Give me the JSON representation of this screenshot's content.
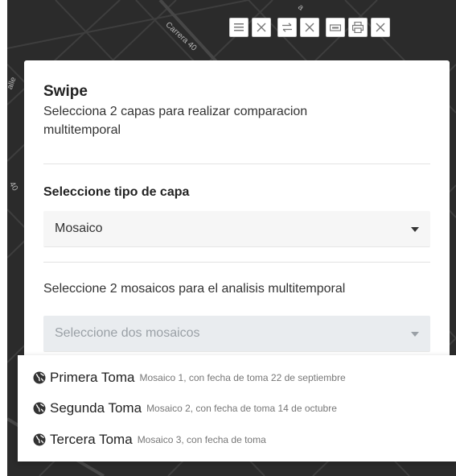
{
  "map": {
    "street_labels": [
      "Carrera 40",
      "alle",
      "40",
      "a"
    ]
  },
  "toolbar": {
    "groups": [
      {
        "icons": [
          "list-icon",
          "close-icon"
        ]
      },
      {
        "icons": [
          "swap-icon",
          "close-icon"
        ]
      },
      {
        "icons": [
          "print-icon",
          "printer-icon",
          "close-icon"
        ]
      }
    ]
  },
  "panel": {
    "title": "Swipe",
    "subtitle": "Selecciona 2 capas para realizar comparacion multitemporal",
    "layer_type_label": "Seleccione tipo de capa",
    "layer_type_value": "Mosaico",
    "mosaics_label": "Seleccione 2 mosaicos para el analisis multitemporal",
    "mosaics_placeholder": "Seleccione dos mosaicos"
  },
  "dropdown": {
    "options": [
      {
        "title": "Primera Toma",
        "description": "Mosaico 1, con fecha de toma 22 de septiembre"
      },
      {
        "title": "Segunda Toma",
        "description": "Mosaico 2, con fecha de toma 14 de octubre"
      },
      {
        "title": "Tercera Toma",
        "description": "Mosaico 3, con fecha de toma"
      }
    ]
  },
  "colors": {
    "map_background": "#2b2b2b",
    "panel_background": "#ffffff",
    "disabled_select": "#e9ecef"
  }
}
